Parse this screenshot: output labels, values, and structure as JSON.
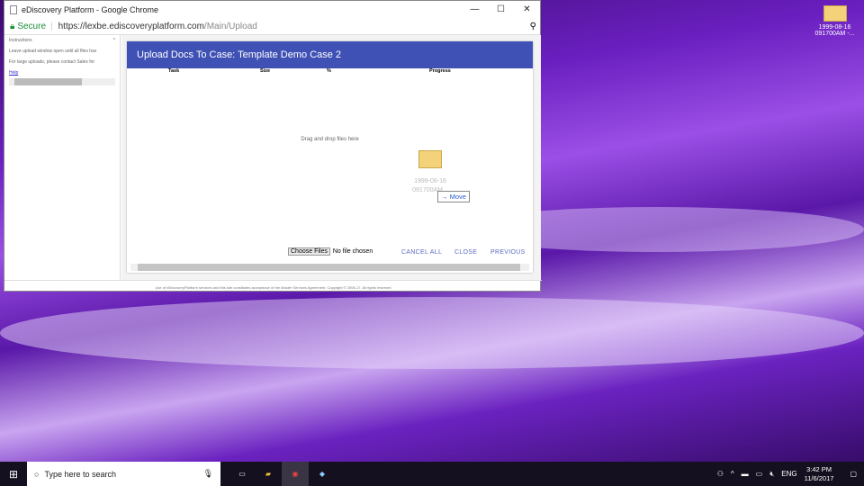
{
  "window": {
    "title": "eDiscovery Platform - Google Chrome",
    "secure_label": "Secure",
    "url_host": "https://lexbe.ediscoveryplatform.com",
    "url_path": "/Main/Upload"
  },
  "sidebar": {
    "title": "Instructions",
    "line1": "Leave upload window open until all files hav",
    "line2": "For large uploads, please contact Sales for",
    "help": "Help"
  },
  "upload": {
    "title": "Upload Docs To Case: Template Demo Case 2",
    "columns": [
      "Task",
      "Size",
      "%",
      "Progress"
    ],
    "drop_text": "Drag and drop files here",
    "choose_files": "Choose Files",
    "no_file": "No file chosen",
    "cancel_all": "CANCEL ALL",
    "close": "CLOSE",
    "previous": "PREVIOUS"
  },
  "drag": {
    "file_name": "1999-08-16 091700AM...",
    "tooltip": "Move"
  },
  "footer": "Use of eDiscoveryPlatform services and this site constitutes acceptance of the Master Services Agreement. Copyright © 2006-17. All rights reserved",
  "desktop": {
    "icon_line1": "1999-08-16",
    "icon_line2": "091700AM -..."
  },
  "taskbar": {
    "search_placeholder": "Type here to search",
    "lang": "ENG",
    "time": "3:42 PM",
    "date": "11/6/2017"
  }
}
